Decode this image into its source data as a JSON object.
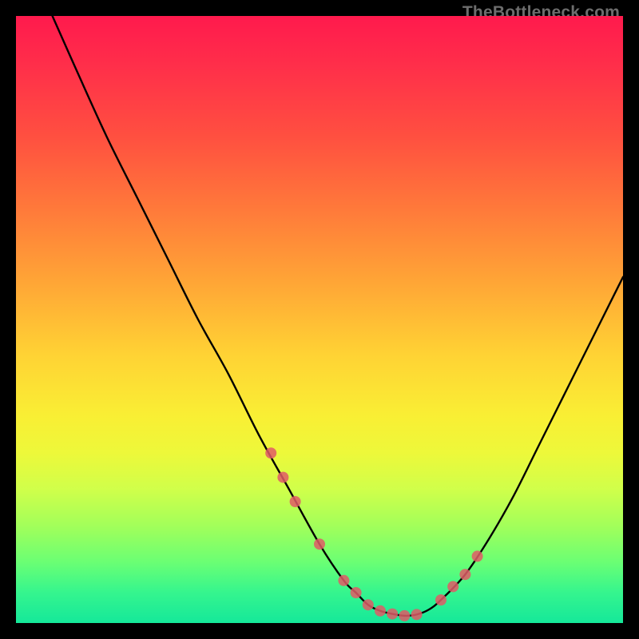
{
  "watermark": "TheBottleneck.com",
  "colors": {
    "background": "#000000",
    "curve": "#000000",
    "marker": "#e05a66",
    "gradient_top": "#ff1a4d",
    "gradient_mid": "#ffd334",
    "gradient_bot": "#15e89a"
  },
  "chart_data": {
    "type": "line",
    "title": "",
    "xlabel": "",
    "ylabel": "",
    "xlim": [
      0,
      100
    ],
    "ylim": [
      0,
      100
    ],
    "grid": false,
    "series": [
      {
        "name": "bottleneck-curve",
        "x": [
          6,
          10,
          15,
          20,
          25,
          30,
          35,
          40,
          45,
          50,
          54,
          56,
          58,
          60,
          62,
          64,
          66,
          68,
          70,
          74,
          78,
          82,
          86,
          90,
          94,
          98,
          100
        ],
        "y": [
          100,
          91,
          80,
          70,
          60,
          50,
          41,
          31,
          22,
          13,
          7,
          5,
          3,
          2,
          1.5,
          1.2,
          1.4,
          2.2,
          3.8,
          8,
          14,
          21,
          29,
          37,
          45,
          53,
          57
        ]
      }
    ],
    "markers": {
      "name": "highlight-points",
      "x": [
        42,
        44,
        46,
        50,
        54,
        56,
        58,
        60,
        62,
        64,
        66,
        70,
        72,
        74,
        76
      ],
      "y": [
        28,
        24,
        20,
        13,
        7,
        5,
        3,
        2,
        1.5,
        1.2,
        1.4,
        3.8,
        6,
        8,
        11
      ]
    }
  }
}
